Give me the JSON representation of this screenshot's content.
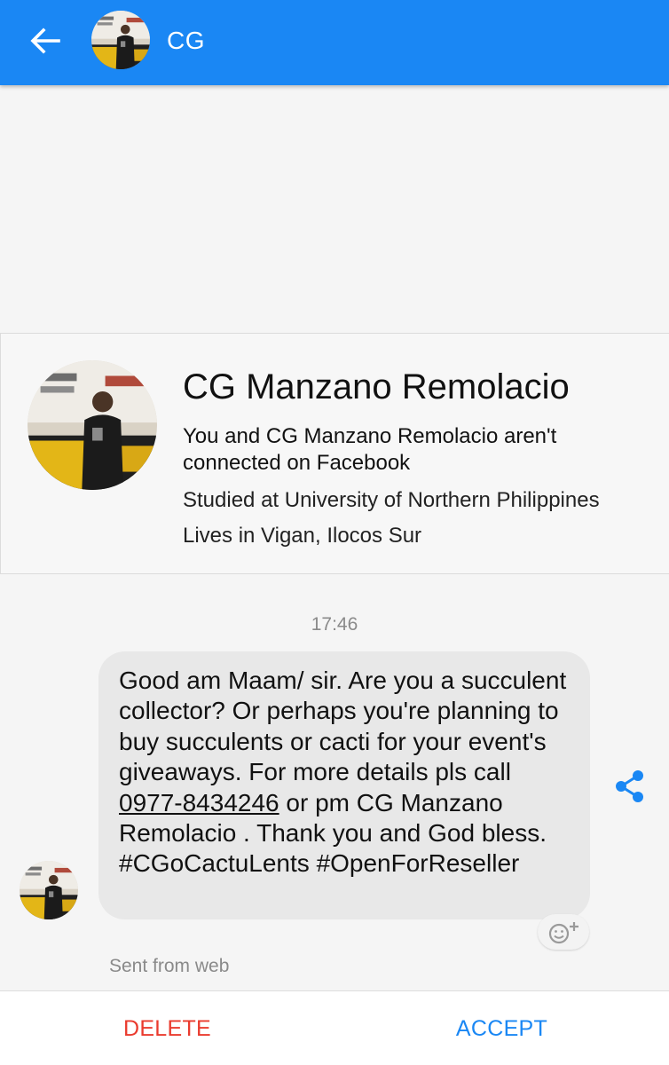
{
  "header": {
    "title": "CG",
    "back_icon": "arrow-left-icon",
    "background": "#1a87f4"
  },
  "profile": {
    "name": "CG Manzano Remolacio",
    "connection_text": "You and CG Manzano Remolacio aren't connected on Facebook",
    "studied": "Studied at University of Northern Philippines",
    "lives": "Lives in Vigan, Ilocos Sur"
  },
  "conversation": {
    "timestamp": "17:46",
    "message": {
      "text_before_phone": "Good am Maam/ sir. Are you a succulent collector? Or perhaps you're planning to buy succulents or cacti for your event's giveaways. For more details pls call ",
      "phone": "0977-8434246",
      "text_after_phone": " or pm CG Manzano Remolacio . Thank you and God bless. #CGoCactuLents #OpenForReseller"
    },
    "share_icon": "share-icon",
    "reaction_icon": "add-reaction-icon",
    "sent_from": "Sent from web"
  },
  "actions": {
    "delete_label": "DELETE",
    "accept_label": "ACCEPT",
    "delete_color": "#ea3b2e",
    "accept_color": "#1a87f4"
  }
}
